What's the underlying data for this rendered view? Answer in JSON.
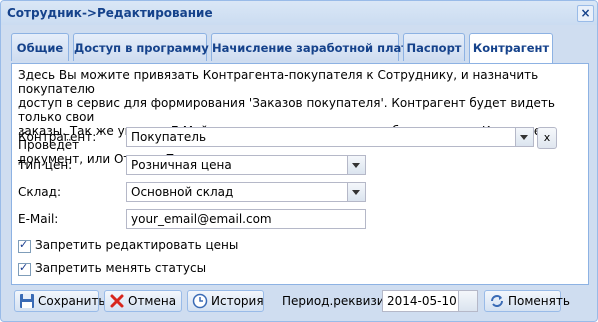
{
  "window": {
    "title": "Сотрудник->Редактирование"
  },
  "tabs": [
    {
      "label": "Общие"
    },
    {
      "label": "Доступ в программу"
    },
    {
      "label": "Начисление заработной платы"
    },
    {
      "label": "Паспорт"
    },
    {
      "label": "Контрагент",
      "active": true
    }
  ],
  "panel": {
    "description_lines": [
      "Здесь Вы можите привязать Контрагента-покупателя к Сотруднику, и назначить покупателю",
      "доступ в сервис для формирования 'Заказов покупателя'. Контрагент будет видеть только свои",
      "заказы. Так же указать E-Майл адрес куда отправятся сообщения, если Контрагент Проведёт",
      "документ, или Отмент Проведение."
    ],
    "counterparty": {
      "label": "Контрагент:",
      "value": "Покупатель",
      "clear_label": "x"
    },
    "price_type": {
      "label": "Тип цен:",
      "value": "Розничная цена"
    },
    "warehouse": {
      "label": "Склад:",
      "value": "Основной склад"
    },
    "email": {
      "label": "E-Mail:",
      "value": "your_email@email.com"
    },
    "checkboxes": [
      {
        "label": "Запретить редактировать цены",
        "checked": true
      },
      {
        "label": "Запретить менять статусы",
        "checked": true
      }
    ]
  },
  "footer": {
    "save_label": "Сохранить",
    "cancel_label": "Отмена",
    "history_label": "История",
    "period_label": "Период.реквизиты:",
    "period_value": "2014-05-10",
    "change_label": "Поменять"
  }
}
